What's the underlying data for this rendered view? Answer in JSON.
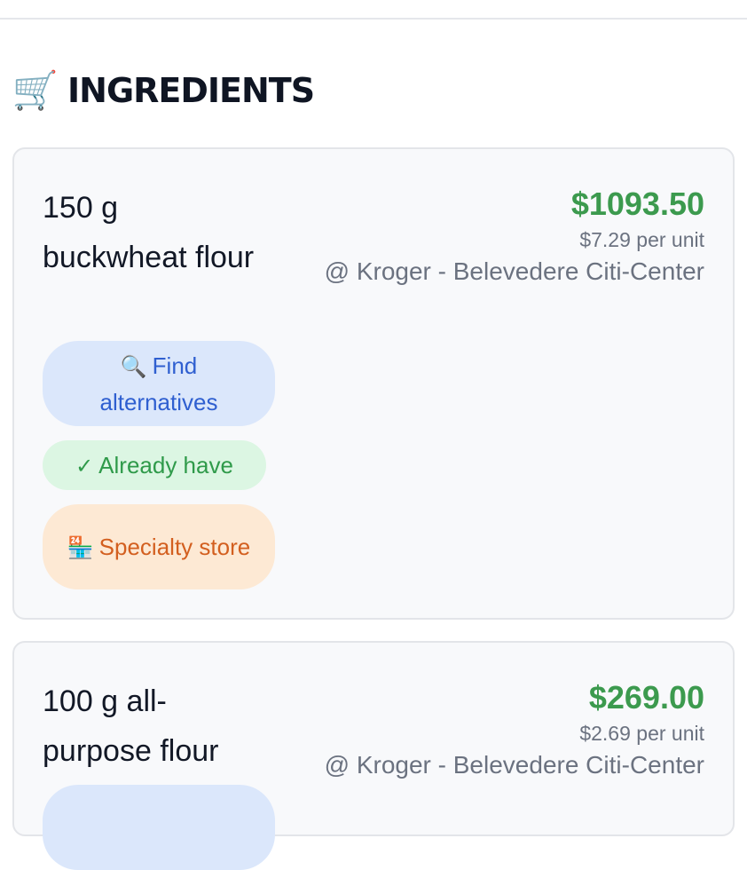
{
  "section": {
    "icon": "shopping-cart-icon",
    "icon_glyph": "🛒",
    "title": "INGREDIENTS"
  },
  "ingredients": [
    {
      "name": "150 g buckwheat flour",
      "total_price": "$1093.50",
      "unit_price": "$7.29 per unit",
      "store": "@ Kroger - Belevedere Citi-Center",
      "actions": {
        "find_icon": "🔍",
        "find_label": "Find alternatives",
        "have_icon": "✓",
        "have_label": "Already have",
        "specialty_icon": "🏪",
        "specialty_label": "Specialty store"
      }
    },
    {
      "name": "100 g all-purpose flour",
      "total_price": "$269.00",
      "unit_price": "$2.69 per unit",
      "store": "@ Kroger - Belevedere Citi-Center"
    }
  ],
  "colors": {
    "price_green": "#3c9a4e",
    "find_bg": "#dbe7fb",
    "find_text": "#2f5fd0",
    "have_bg": "#dcf6e3",
    "have_text": "#2f9a4a",
    "specialty_bg": "#fde9d4",
    "specialty_text": "#d35f1f"
  }
}
